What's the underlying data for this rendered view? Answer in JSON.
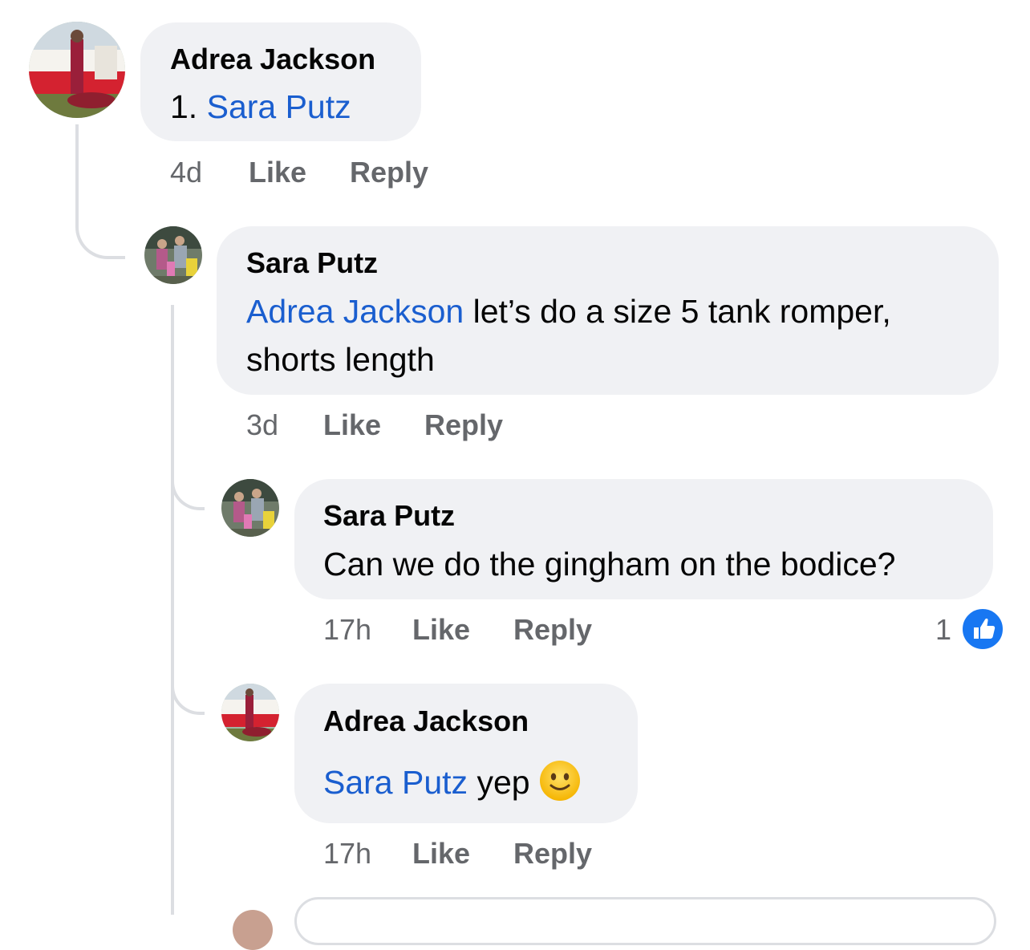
{
  "comments": [
    {
      "author": "Adrea Jackson",
      "prefix": "1. ",
      "mention": "Sara Putz",
      "text": "",
      "time": "4d",
      "like_label": "Like",
      "reply_label": "Reply"
    },
    {
      "author": "Sara Putz",
      "mention": "Adrea Jackson",
      "text_line1": " let’s do a size 5 tank romper,",
      "text_line2": "shorts length",
      "time": "3d",
      "like_label": "Like",
      "reply_label": "Reply"
    },
    {
      "author": "Sara Putz",
      "text": "Can we do the gingham on the bodice?",
      "time": "17h",
      "like_label": "Like",
      "reply_label": "Reply",
      "reaction_count": "1",
      "reaction_icon": "thumbs-up-icon"
    },
    {
      "author": "Adrea Jackson",
      "mention": "Sara Putz",
      "text": " yep ",
      "emoji": "slightly-smiling-face-icon",
      "time": "17h",
      "like_label": "Like",
      "reply_label": "Reply"
    }
  ],
  "colors": {
    "mention": "#1a5ecf",
    "bubble": "#f0f1f4",
    "meta": "#65676b",
    "like_badge": "#1877f2"
  }
}
